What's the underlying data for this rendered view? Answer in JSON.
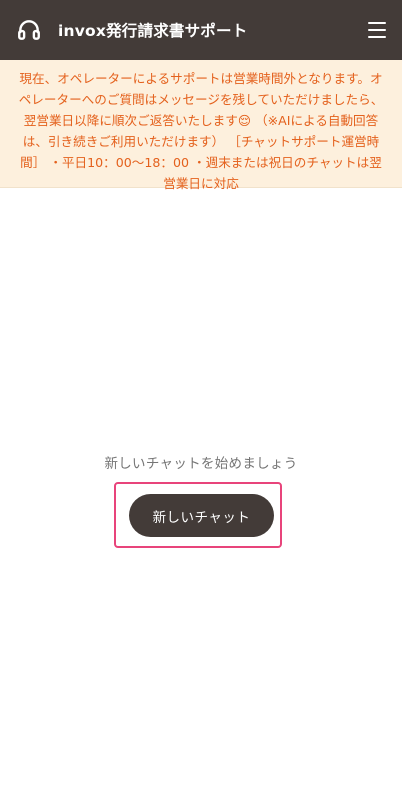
{
  "header": {
    "title": "invox発行請求書サポート",
    "left_icon": "headset-icon",
    "right_icon": "hamburger-menu-icon"
  },
  "notice": {
    "text": "現在、オペレーターによるサポートは営業時間外となります。オペレーターへのご質問はメッセージを残していただけましたら、翌営業日以降に順次ご返答いたします😌 （※AIによる自動回答は、引き続きご利用いただけます） ［チャットサポート運営時間］ ・平日10：00〜18：00 ・週末または祝日のチャットは翌営業日に対応"
  },
  "main": {
    "empty_message": "新しいチャットを始めましょう",
    "new_chat_label": "新しいチャット"
  },
  "colors": {
    "header_bg": "#433b38",
    "notice_bg": "#fdf0dd",
    "notice_text": "#e4611d",
    "button_bg": "#433b38",
    "highlight": "#e8447b"
  }
}
